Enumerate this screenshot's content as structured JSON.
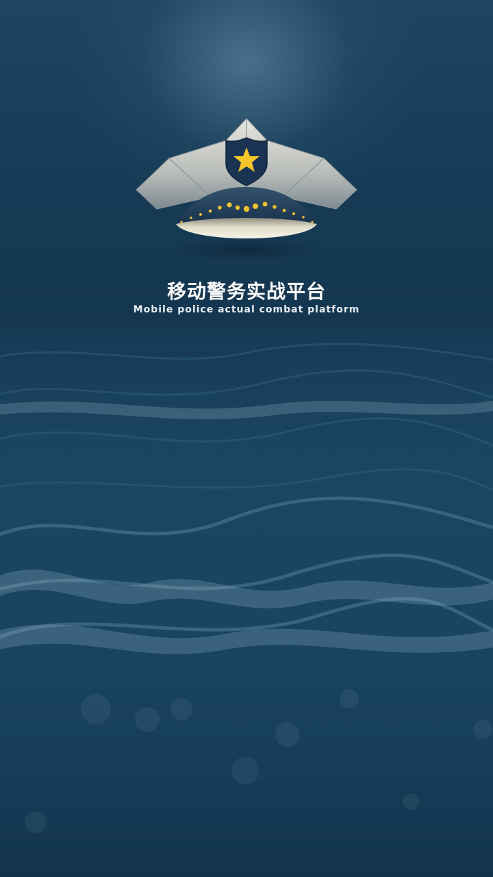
{
  "splash": {
    "title": "移动警务实战平台",
    "subtitle": "Mobile police actual combat platform",
    "logo_icon": "police-cap-icon",
    "colors": {
      "background": "#143650",
      "star": "#f5c52a",
      "cap_silver": "#c9ccc8",
      "badge": "#1a3352"
    }
  }
}
